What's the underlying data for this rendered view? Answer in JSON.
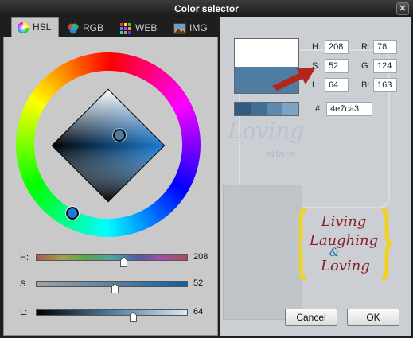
{
  "window": {
    "title": "Color selector",
    "close_icon": "close-icon"
  },
  "tabs": [
    {
      "label": "HSL",
      "icon": "color-wheel-icon",
      "active": true
    },
    {
      "label": "RGB",
      "icon": "rgb-circles-icon",
      "active": false
    },
    {
      "label": "WEB",
      "icon": "web-palette-icon",
      "active": false
    },
    {
      "label": "IMG",
      "icon": "image-icon",
      "active": false
    }
  ],
  "color": {
    "hex": "4e7ca3",
    "hsl": {
      "H": "208",
      "S": "52",
      "L": "64"
    },
    "rgb": {
      "R": "78",
      "G": "124",
      "B": "163"
    },
    "preview_new": "#ffffff",
    "preview_old": "#4e7ca3"
  },
  "fields": {
    "h_label": "H:",
    "s_label": "S:",
    "l_label": "L:",
    "r_label": "R:",
    "g_label": "G:",
    "b_label": "B:",
    "hex_label": "#"
  },
  "swatches": [
    "#2f5c80",
    "#40709a",
    "#5d8ab0",
    "#7ea3c4"
  ],
  "sliders": [
    {
      "label": "H:",
      "value": "208",
      "fraction": 0.578
    },
    {
      "label": "S:",
      "value": "52",
      "fraction": 0.52
    },
    {
      "label": "L:",
      "value": "64",
      "fraction": 0.64
    }
  ],
  "buttons": {
    "cancel": "Cancel",
    "ok": "OK"
  },
  "background": {
    "script_text_1": "Loving",
    "script_text_2": "arfare",
    "logo_text": [
      "Living",
      "Laughing",
      "&",
      "Loving"
    ]
  },
  "annotation": {
    "arrow_color": "#b3261e"
  }
}
